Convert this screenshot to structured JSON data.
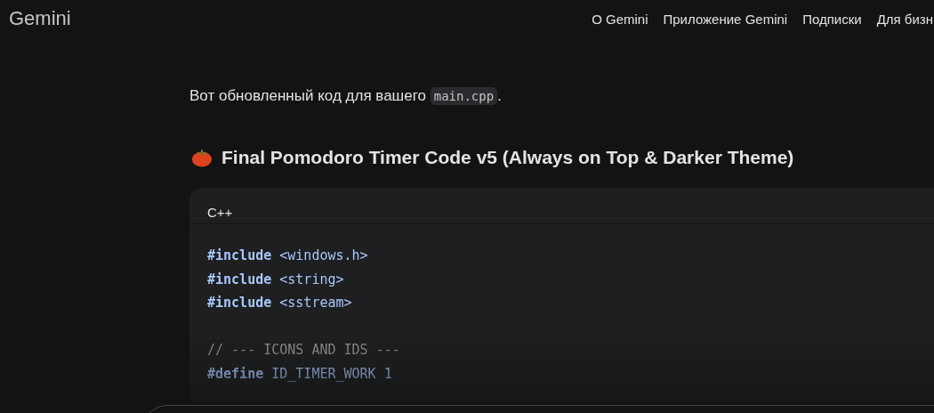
{
  "header": {
    "logo": "Gemini",
    "nav": [
      "О Gemini",
      "Приложение Gemini",
      "Подписки",
      "Для бизн"
    ]
  },
  "message": {
    "intro_before": "Вот обновленный код для вашего",
    "intro_code": "main.cpp",
    "intro_after": ".",
    "heading": "Final Pomodoro Timer Code v5 (Always on Top & Darker Theme)",
    "code_block": {
      "language": "C++",
      "lines": [
        {
          "kind": "directive",
          "keyword": "#include",
          "rest": "<windows.h>"
        },
        {
          "kind": "directive",
          "keyword": "#include",
          "rest": "<string>"
        },
        {
          "kind": "directive",
          "keyword": "#include",
          "rest": "<sstream>"
        },
        {
          "kind": "blank"
        },
        {
          "kind": "comment",
          "text": "// --- ICONS AND IDS ---"
        },
        {
          "kind": "directive",
          "keyword": "#define",
          "rest": "ID_TIMER_WORK 1"
        }
      ]
    }
  },
  "prompt": {
    "kind": "input"
  }
}
